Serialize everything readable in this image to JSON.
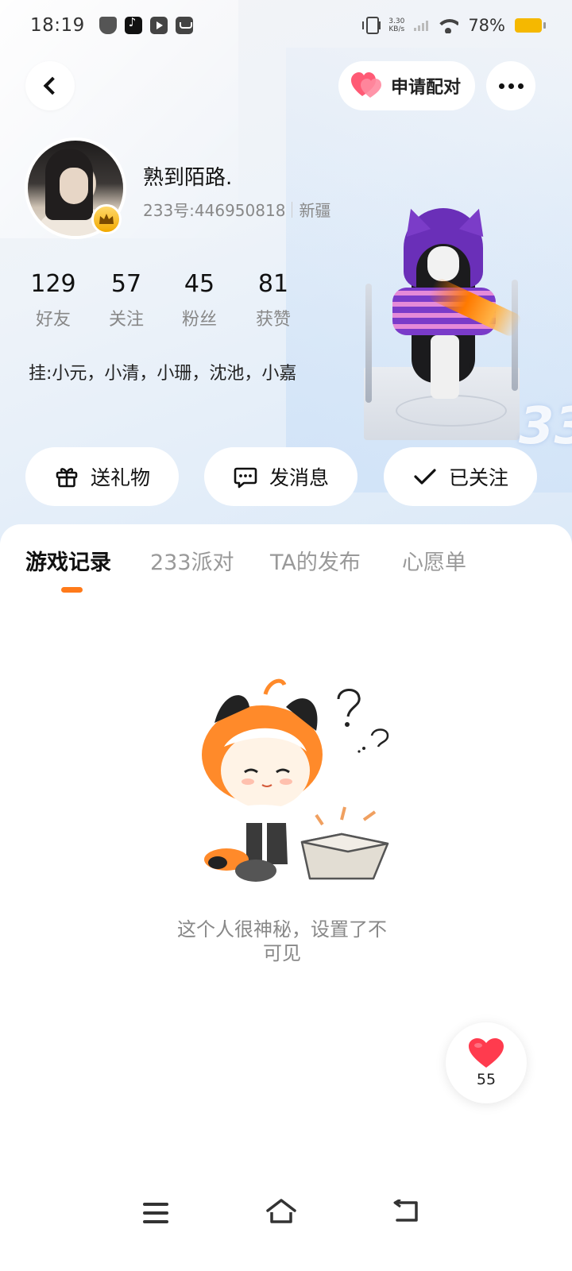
{
  "status_bar": {
    "time": "18:19",
    "net_speed_value": "3.30",
    "net_speed_unit": "KB/s",
    "battery": "78%",
    "battery_color": "#f5b800"
  },
  "header": {
    "back_icon": "chevron-left-icon",
    "match_label": "申请配对",
    "more_icon": "more-dots-icon"
  },
  "profile": {
    "nickname": "熟到陌路.",
    "id_text": "233号:446950818",
    "location": "新疆",
    "badge_icon": "crown-icon",
    "stats": [
      {
        "value": "129",
        "label": "好友"
      },
      {
        "value": "57",
        "label": "关注"
      },
      {
        "value": "45",
        "label": "粉丝"
      },
      {
        "value": "81",
        "label": "获赞"
      }
    ],
    "hang_text": "挂:小元，小清，小珊，沈池，小嘉"
  },
  "actions": {
    "gift_label": "送礼物",
    "message_label": "发消息",
    "followed_label": "已关注"
  },
  "tabs": [
    {
      "label": "游戏记录",
      "active": true
    },
    {
      "label": "233派对",
      "active": false
    },
    {
      "label": "TA的发布",
      "active": false
    },
    {
      "label": "心愿单",
      "active": false
    }
  ],
  "empty_state": {
    "line1": "这个人很神秘，设置了不",
    "line2": "可见"
  },
  "like": {
    "count": "55",
    "color": "#ff3b4e"
  },
  "colors": {
    "accent": "#ff7a1a"
  }
}
